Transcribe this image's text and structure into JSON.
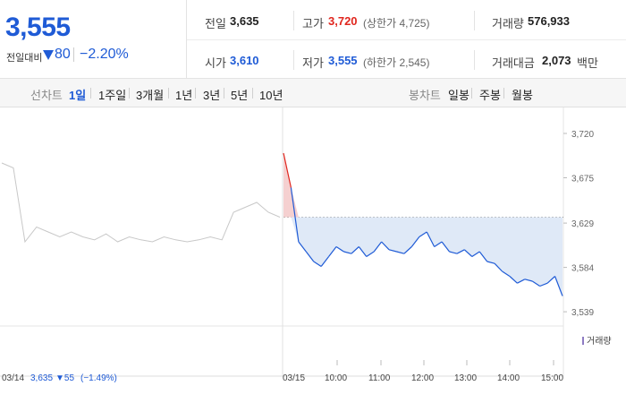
{
  "header": {
    "price": "3,555",
    "change_label": "전일대비",
    "change_value": "80",
    "change_pct": "−2.20%",
    "stats": [
      {
        "key": "전일",
        "value": "3,635",
        "tone": "normal",
        "sub": ""
      },
      {
        "key": "고가",
        "value": "3,720",
        "tone": "up",
        "sub": "(상한가 4,725)"
      },
      {
        "key": "거래량",
        "value": "576,933",
        "tone": "normal",
        "sub": ""
      },
      {
        "key": "시가",
        "value": "3,610",
        "tone": "down",
        "sub": ""
      },
      {
        "key": "저가",
        "value": "3,555",
        "tone": "down",
        "sub": "(하한가 2,545)"
      },
      {
        "key": "거래대금",
        "value": "2,073",
        "tone": "normal",
        "sub": "백만"
      }
    ]
  },
  "tabs": {
    "line_label": "선차트",
    "line_periods": [
      "1일",
      "1주일",
      "3개월",
      "1년",
      "3년",
      "5년",
      "10년"
    ],
    "selected": "1일",
    "candle_label": "봉차트",
    "candle_periods": [
      "일봉",
      "주봉",
      "월봉"
    ]
  },
  "colors": {
    "up": "#e0261e",
    "down": "#1f5bd6",
    "prev_line": "#c8c8c8",
    "fill": "#dfe9f7"
  },
  "chart_data": {
    "type": "line",
    "y_ticks": [
      "3,720",
      "3,675",
      "3,629",
      "3,584",
      "3,539"
    ],
    "ylim": [
      3530,
      3730
    ],
    "reference_price": 3635,
    "previous_day": {
      "label": "03/14",
      "close": "3,635",
      "change": "▼55",
      "change_pct": "(−1.49%)",
      "values": [
        3690,
        3685,
        3610,
        3625,
        3620,
        3615,
        3620,
        3615,
        3612,
        3618,
        3610,
        3615,
        3612,
        3610,
        3615,
        3612,
        3610,
        3612,
        3615,
        3612,
        3640,
        3645,
        3650,
        3640,
        3635
      ]
    },
    "today": {
      "label": "03/15",
      "x_ticks": [
        "10:00",
        "11:00",
        "12:00",
        "13:00",
        "14:00",
        "15:00"
      ],
      "values": [
        3700,
        3665,
        3610,
        3600,
        3590,
        3585,
        3595,
        3605,
        3600,
        3598,
        3605,
        3595,
        3600,
        3610,
        3602,
        3600,
        3598,
        3605,
        3615,
        3620,
        3605,
        3610,
        3600,
        3598,
        3602,
        3595,
        3600,
        3590,
        3588,
        3580,
        3575,
        3568,
        3572,
        3570,
        3565,
        3568,
        3575,
        3555
      ]
    },
    "volume_label": "거래량"
  }
}
